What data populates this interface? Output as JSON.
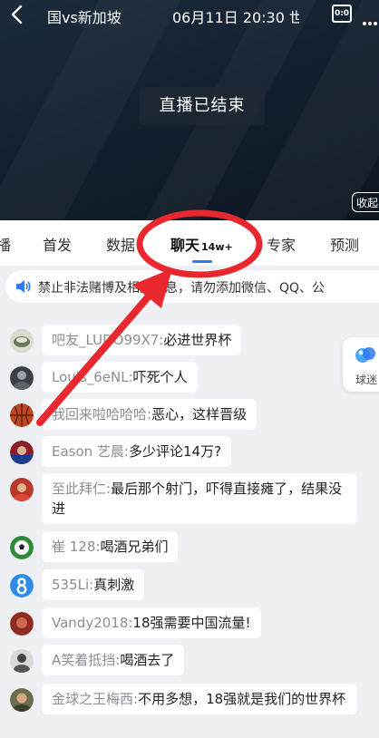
{
  "header": {
    "match_title": "国vs新加坡",
    "match_time": "06月11日 20:30 世",
    "score_icon_text": "0:0",
    "status_text": "直播已结束",
    "collapse_label": "收起"
  },
  "tabs": [
    {
      "label": "播"
    },
    {
      "label": "首发"
    },
    {
      "label": "数据"
    },
    {
      "label": "聊天",
      "badge": "14w+"
    },
    {
      "label": "专家"
    },
    {
      "label": "预测"
    }
  ],
  "notice": {
    "text": "禁止非法赌博及相关信息，请勿添加微信、QQ、公"
  },
  "fans_widget": {
    "label": "球迷"
  },
  "messages": [
    {
      "user": "吧友_LUDO99X7:",
      "text": "必进世界杯"
    },
    {
      "user": "Louis_6eNL:",
      "text": "吓死个人"
    },
    {
      "user": "我回来啦哈哈哈:",
      "text": "恶心，这样晋级"
    },
    {
      "user": "Eason 艺晨:",
      "text": "多少评论14万?"
    },
    {
      "user": "至此拜仁:",
      "text": "最后那个射门，吓得直接瘫了，结果没进"
    },
    {
      "user": "崔 128:",
      "text": "喝酒兄弟们"
    },
    {
      "user": "535Li:",
      "text": "真刺激"
    },
    {
      "user": "Vandy2018:",
      "text": "18强需要中国流量!"
    },
    {
      "user": "A笑着抵挡:",
      "text": "喝酒去了"
    },
    {
      "user": "金球之王梅西:",
      "text": "不用多想，18强就是我们的世界杯"
    }
  ],
  "colors": {
    "accent": "#2b7cf6",
    "annotation": "#e8282e"
  }
}
